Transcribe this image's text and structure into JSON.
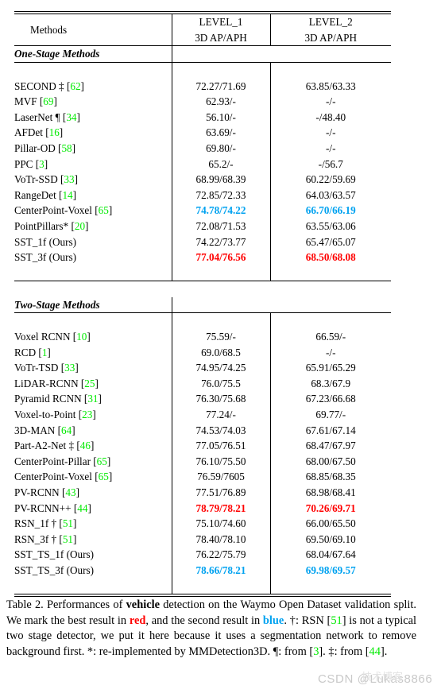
{
  "table": {
    "columns": [
      {
        "key": "method",
        "header_line1": "Methods",
        "header_line2": ""
      },
      {
        "key": "level1",
        "header_line1": "LEVEL_1",
        "header_line2": "3D AP/APH"
      },
      {
        "key": "level2",
        "header_line1": "LEVEL_2",
        "header_line2": "3D AP/APH"
      }
    ],
    "sections": [
      {
        "title": "One-Stage Methods",
        "rows": [
          {
            "name": "SECOND ‡",
            "cite": "62",
            "level1": "72.27/71.69",
            "level2": "63.85/63.33",
            "l1_style": "normal",
            "l2_style": "normal"
          },
          {
            "name": "MVF",
            "cite": "69",
            "level1": "62.93/-",
            "level2": "-/-",
            "l1_style": "normal",
            "l2_style": "normal"
          },
          {
            "name": "LaserNet ¶",
            "cite": "34",
            "level1": "56.10/-",
            "level2": "-/48.40",
            "l1_style": "normal",
            "l2_style": "normal"
          },
          {
            "name": "AFDet",
            "cite": "16",
            "level1": "63.69/-",
            "level2": "-/-",
            "l1_style": "normal",
            "l2_style": "normal"
          },
          {
            "name": "Pillar-OD",
            "cite": "58",
            "level1": "69.80/-",
            "level2": "-/-",
            "l1_style": "normal",
            "l2_style": "normal"
          },
          {
            "name": "PPC",
            "cite": "3",
            "level1": "65.2/-",
            "level2": "-/56.7",
            "l1_style": "normal",
            "l2_style": "normal"
          },
          {
            "name": "VoTr-SSD",
            "cite": "33",
            "level1": "68.99/68.39",
            "level2": "60.22/59.69",
            "l1_style": "normal",
            "l2_style": "normal"
          },
          {
            "name": "RangeDet",
            "cite": "14",
            "level1": "72.85/72.33",
            "level2": "64.03/63.57",
            "l1_style": "normal",
            "l2_style": "normal"
          },
          {
            "name": "CenterPoint-Voxel",
            "cite": "65",
            "level1": "74.78/74.22",
            "level2": "66.70/66.19",
            "l1_style": "blue",
            "l2_style": "blue"
          },
          {
            "name": "PointPillars*",
            "cite": "20",
            "level1": "72.08/71.53",
            "level2": "63.55/63.06",
            "l1_style": "normal",
            "l2_style": "normal"
          },
          {
            "name": "SST_1f (Ours)",
            "cite": "",
            "level1": "74.22/73.77",
            "level2": "65.47/65.07",
            "l1_style": "normal",
            "l2_style": "normal"
          },
          {
            "name": "SST_3f (Ours)",
            "cite": "",
            "level1": "77.04/76.56",
            "level2": "68.50/68.08",
            "l1_style": "red",
            "l2_style": "red"
          }
        ]
      },
      {
        "title": "Two-Stage Methods",
        "rows": [
          {
            "name": "Voxel RCNN",
            "cite": "10",
            "level1": "75.59/-",
            "level2": "66.59/-",
            "l1_style": "normal",
            "l2_style": "normal"
          },
          {
            "name": "RCD",
            "cite": "1",
            "level1": "69.0/68.5",
            "level2": "-/-",
            "l1_style": "normal",
            "l2_style": "normal"
          },
          {
            "name": "VoTr-TSD",
            "cite": "33",
            "level1": "74.95/74.25",
            "level2": "65.91/65.29",
            "l1_style": "normal",
            "l2_style": "normal"
          },
          {
            "name": "LiDAR-RCNN",
            "cite": "25",
            "level1": "76.0/75.5",
            "level2": "68.3/67.9",
            "l1_style": "normal",
            "l2_style": "normal"
          },
          {
            "name": "Pyramid RCNN",
            "cite": "31",
            "level1": "76.30/75.68",
            "level2": "67.23/66.68",
            "l1_style": "normal",
            "l2_style": "normal"
          },
          {
            "name": "Voxel-to-Point",
            "cite": "23",
            "level1": "77.24/-",
            "level2": "69.77/-",
            "l1_style": "normal",
            "l2_style": "normal"
          },
          {
            "name": "3D-MAN",
            "cite": "64",
            "level1": "74.53/74.03",
            "level2": "67.61/67.14",
            "l1_style": "normal",
            "l2_style": "normal"
          },
          {
            "name": "Part-A2-Net ‡",
            "cite": "46",
            "level1": "77.05/76.51",
            "level2": "68.47/67.97",
            "l1_style": "normal",
            "l2_style": "normal"
          },
          {
            "name": "CenterPoint-Pillar",
            "cite": "65",
            "level1": "76.10/75.50",
            "level2": "68.00/67.50",
            "l1_style": "normal",
            "l2_style": "normal"
          },
          {
            "name": "CenterPoint-Voxel",
            "cite": "65",
            "level1": "76.59/7605",
            "level2": "68.85/68.35",
            "l1_style": "normal",
            "l2_style": "normal"
          },
          {
            "name": "PV-RCNN",
            "cite": "43",
            "level1": "77.51/76.89",
            "level2": "68.98/68.41",
            "l1_style": "normal",
            "l2_style": "normal"
          },
          {
            "name": "PV-RCNN++",
            "cite": "44",
            "level1": "78.79/78.21",
            "level2": "70.26/69.71",
            "l1_style": "red",
            "l2_style": "red"
          },
          {
            "name": "RSN_1f †",
            "cite": "51",
            "level1": "75.10/74.60",
            "level2": "66.00/65.50",
            "l1_style": "normal",
            "l2_style": "normal"
          },
          {
            "name": "RSN_3f †",
            "cite": "51",
            "level1": "78.40/78.10",
            "level2": "69.50/69.10",
            "l1_style": "normal",
            "l2_style": "normal"
          },
          {
            "name": "SST_TS_1f (Ours)",
            "cite": "",
            "level1": "76.22/75.79",
            "level2": "68.04/67.64",
            "l1_style": "normal",
            "l2_style": "normal"
          },
          {
            "name": "SST_TS_3f (Ours)",
            "cite": "",
            "level1": "78.66/78.21",
            "level2": "69.98/69.57",
            "l1_style": "blue",
            "l2_style": "blue"
          }
        ]
      }
    ]
  },
  "caption": {
    "label": "Table 2.",
    "part1": "Performances of ",
    "bold1": "vehicle",
    "part2": " detection on the Waymo Open Dataset validation split. We mark the best result in ",
    "red_word": "red",
    "part3": ", and the second result in ",
    "blue_word": "blue",
    "part4": ". †: RSN [",
    "cite1": "51",
    "part5": "] is not a typical two stage detector, we put it here because it uses a segmentation network to remove background first. *: re-implemented by MMDetection3D. ¶: from [",
    "cite2": "3",
    "part6": "]. ‡: from [",
    "cite3": "44",
    "part7": "]."
  },
  "watermark": {
    "text": "CSDN @Lukas8866",
    "cjk": "技术博客"
  },
  "colors": {
    "citation_green": "#00ea00",
    "best_red": "#ff0000",
    "second_blue": "#00a2f0",
    "watermark_gray": "#c9c9c9"
  }
}
